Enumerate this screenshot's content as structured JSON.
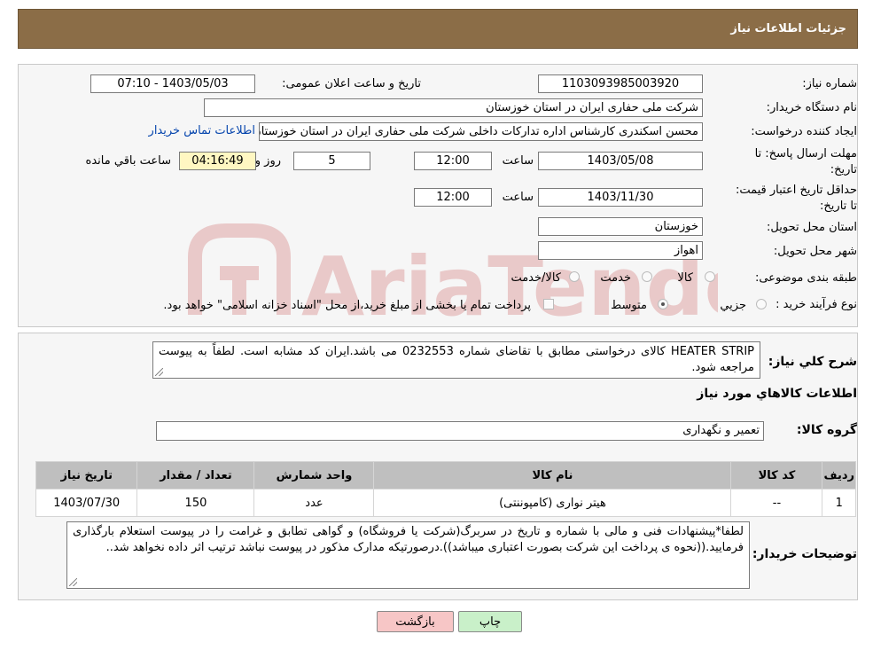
{
  "header": {
    "title": "جزئیات اطلاعات نیاز"
  },
  "form": {
    "need_number_label": "شماره نیاز:",
    "need_number": "1103093985003920",
    "announce_label": "تاریخ و ساعت اعلان عمومی:",
    "announce_value": "1403/05/03 - 07:10",
    "buyer_org_label": "نام دستگاه خریدار:",
    "buyer_org": "شرکت ملی حفاری ایران در استان خوزستان",
    "creator_label": "ایجاد کننده درخواست:",
    "creator": "محسن اسکندری کارشناس اداره تدارکات داخلی  شرکت ملی حفاری ایران در استان خوزستان",
    "buyer_contact_link": "اطلاعات تماس خریدار",
    "deadline_label": "مهلت ارسال پاسخ: تا تاریخ:",
    "deadline_date": "1403/05/08",
    "time_label": "ساعت",
    "deadline_time": "12:00",
    "days_count": "5",
    "days_label": "روز و",
    "remaining_time": "04:16:49",
    "remaining_label": "ساعت باقي مانده",
    "validity_label": "حداقل تاریخ اعتبار قیمت: تا تاریخ:",
    "validity_date": "1403/11/30",
    "validity_time": "12:00",
    "province_label": "استان محل تحویل:",
    "province": "خوزستان",
    "city_label": "شهر محل تحویل:",
    "city": "اهواز",
    "category_label": "طبقه بندی موضوعی:",
    "category_options": [
      "کالا",
      "خدمت",
      "کالا/خدمت"
    ],
    "process_label": "نوع فرآیند خرید :",
    "process_options": [
      "جزیي",
      "متوسط"
    ],
    "payment_note": "پرداخت تمام یا بخشی از مبلغ خرید،از محل \"اسناد خزانه اسلامی\" خواهد بود."
  },
  "details": {
    "summary_label": "شرح کلي نياز:",
    "summary_text": "HEATER STRIP کالای درخواستی مطابق با تقاضای شماره 0232553 می باشد.ایران کد مشابه است. لطفاً به پیوست مراجعه شود.",
    "goods_info_title": "اطلاعات کالاهاي مورد نياز",
    "goods_group_label": "گروه کالا:",
    "goods_group": "تعمیر و نگهداری",
    "table": {
      "headers": [
        "رديف",
        "کد کالا",
        "نام کالا",
        "واحد شمارش",
        "تعداد / مقدار",
        "تاریخ نیاز"
      ],
      "rows": [
        [
          "1",
          "--",
          "هیتر نواری (کامپوننتی)",
          "عدد",
          "150",
          "1403/07/30"
        ]
      ]
    },
    "buyer_notes_label": "توضیحات خریدار:",
    "buyer_notes": "لطفا*پیشنهادات فنی و مالی با شماره و تاریخ در سربرگ(شرکت یا فروشگاه) و گواهی تطابق و غرامت را در پیوست استعلام بارگذاری فرمایید.((نحوه ی پرداخت این شرکت بصورت اعتباری میباشد)).درصورتیکه مدارک مذکور در پیوست نباشد ترتیب اثر داده نخواهد شد.."
  },
  "buttons": {
    "print": "چاپ",
    "back": "بازگشت"
  },
  "watermark": {
    "text": "AriaTender.neT"
  },
  "colors": {
    "header_bg": "#8b6d47",
    "panel_bg": "#f6f6f6",
    "table_header_bg": "#bfbfbf",
    "print_button_bg": "#c9f0c9",
    "back_button_bg": "#f7c6c6",
    "watermark": "#e9c9c9"
  }
}
